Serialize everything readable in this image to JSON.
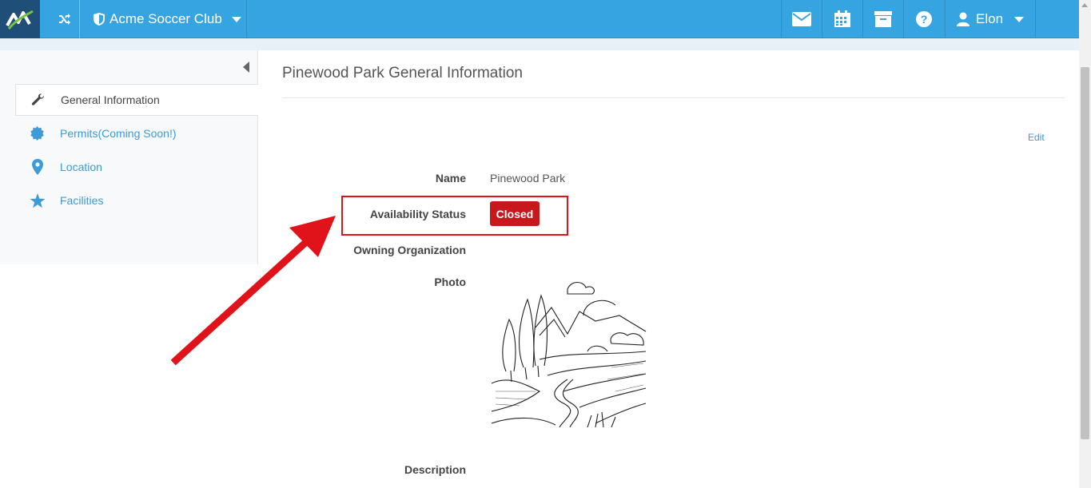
{
  "topbar": {
    "org_name": "Acme Soccer Club",
    "user_name": "Elon",
    "icons": [
      "logo-icon",
      "shuffle-icon",
      "shield-icon",
      "envelope-icon",
      "calendar-icon",
      "archive-icon",
      "help-icon",
      "user-icon"
    ],
    "bar_color": "#36a4e0"
  },
  "sidebar": {
    "items": [
      {
        "label": "General Information",
        "icon": "wrench-icon",
        "active": true
      },
      {
        "label": "Permits(Coming Soon!)",
        "icon": "badge-icon",
        "active": false
      },
      {
        "label": "Location",
        "icon": "map-marker-icon",
        "active": false
      },
      {
        "label": "Facilities",
        "icon": "star-icon",
        "active": false
      }
    ]
  },
  "main": {
    "title": "Pinewood Park General Information",
    "edit_label": "Edit",
    "fields": {
      "name_label": "Name",
      "name_value": "Pinewood Park",
      "availability_label": "Availability Status",
      "availability_value": "Closed",
      "owning_org_label": "Owning Organization",
      "photo_label": "Photo",
      "description_label": "Description"
    },
    "status_color": "#c9171e"
  },
  "annotation": {
    "highlight_color": "#e1131a"
  }
}
